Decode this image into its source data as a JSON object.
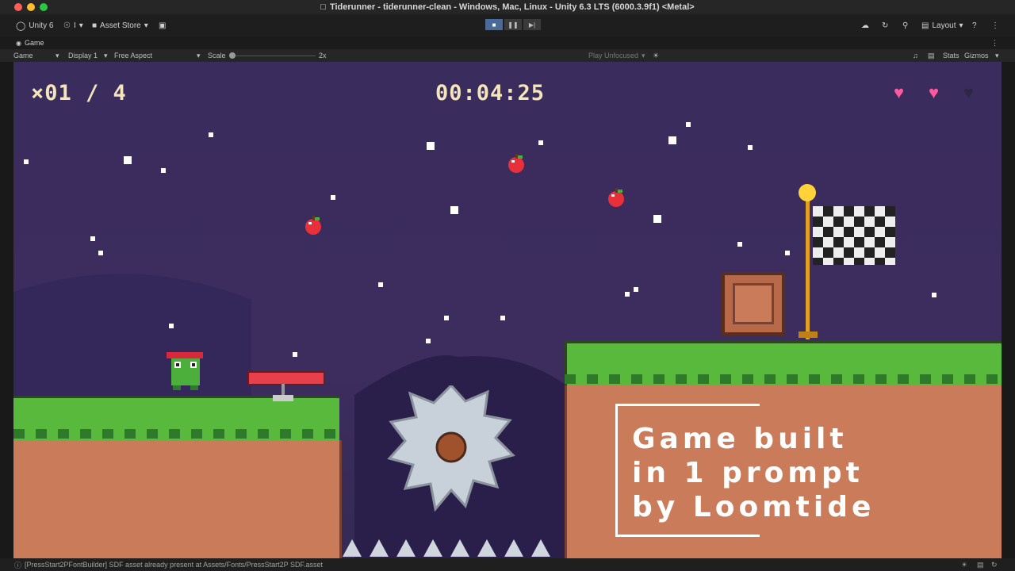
{
  "window": {
    "title": "Tiderunner - tiderunner-clean - Windows, Mac, Linux - Unity 6.3 LTS (6000.3.9f1) <Metal>"
  },
  "toolbar": {
    "unity_label": "Unity 6",
    "account_label": "I",
    "asset_store_label": "Asset Store",
    "layout_label": "Layout"
  },
  "tabs": {
    "game_tab": "Game"
  },
  "gamebar": {
    "mode": "Game",
    "display": "Display 1",
    "aspect": "Free Aspect",
    "scale_label": "Scale",
    "scale_value": "2x",
    "play_focus": "Play Unfocused",
    "stats": "Stats",
    "gizmos": "Gizmos"
  },
  "hud": {
    "counter": "×01 / 4",
    "timer": "00:04:25",
    "hearts_full": 2,
    "hearts_total": 3
  },
  "overlay": {
    "text": "Game built\nin 1 prompt\nby Loomtide"
  },
  "status": {
    "message": "[PressStart2PFontBuilder] SDF asset already present at Assets/Fonts/PressStart2P SDF.asset"
  },
  "colors": {
    "sky": "#3a2c5c",
    "grass": "#4caf3c",
    "dirt": "#c97b5a",
    "heart": "#ff5aa0",
    "hud_text": "#f4e6ba"
  }
}
